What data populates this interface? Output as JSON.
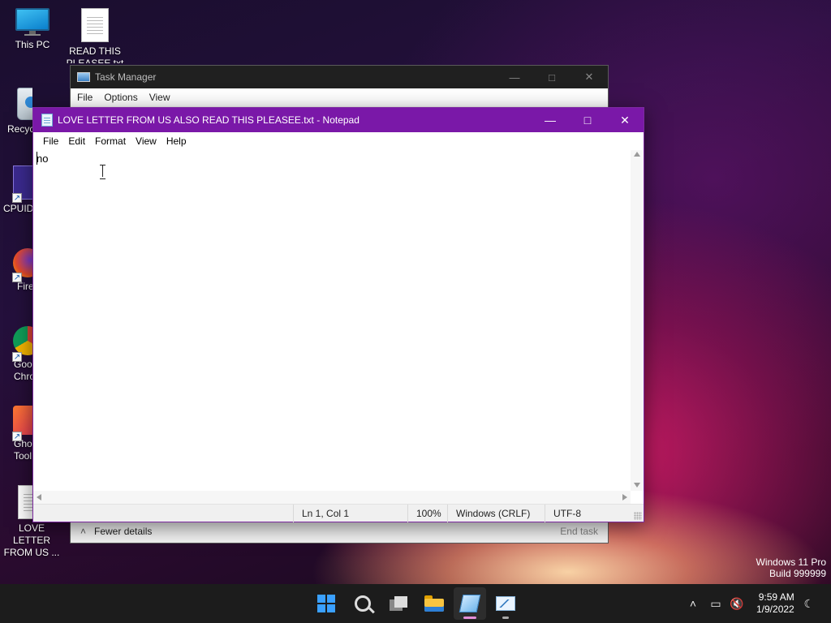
{
  "desktop": {
    "icons": [
      {
        "label": "This PC"
      },
      {
        "label": "READ THIS PLEASEE.txt"
      },
      {
        "label": "Recyc"
      },
      {
        "label": "CPUID"
      },
      {
        "label": "Fire"
      },
      {
        "label": "Goo Chro"
      },
      {
        "label": "Gho Tool"
      },
      {
        "label": "LOVE LETTER FROM US ..."
      }
    ]
  },
  "task_manager": {
    "title": "Task Manager",
    "menu": [
      "File",
      "Options",
      "View"
    ],
    "footer": {
      "details": "Fewer details",
      "end_task": "End task"
    },
    "icon": "task-manager-icon"
  },
  "notepad": {
    "title": "LOVE LETTER FROM US ALSO READ THIS PLEASEE.txt - Notepad",
    "menu": [
      "File",
      "Edit",
      "Format",
      "View",
      "Help"
    ],
    "content": "no",
    "status": {
      "position": "Ln 1, Col 1",
      "zoom": "100%",
      "line_ending": "Windows (CRLF)",
      "encoding": "UTF-8"
    },
    "title_bar_color": "#7a18a8"
  },
  "watermark": {
    "line1": "Windows 11 Pro",
    "line2": "Build 999999"
  },
  "taskbar": {
    "apps": [
      "start-icon",
      "search-icon",
      "task-view-icon",
      "file-explorer-icon",
      "notepad-icon",
      "task-manager-icon"
    ],
    "clock": {
      "time": "9:59 AM",
      "date": "1/9/2022"
    }
  }
}
